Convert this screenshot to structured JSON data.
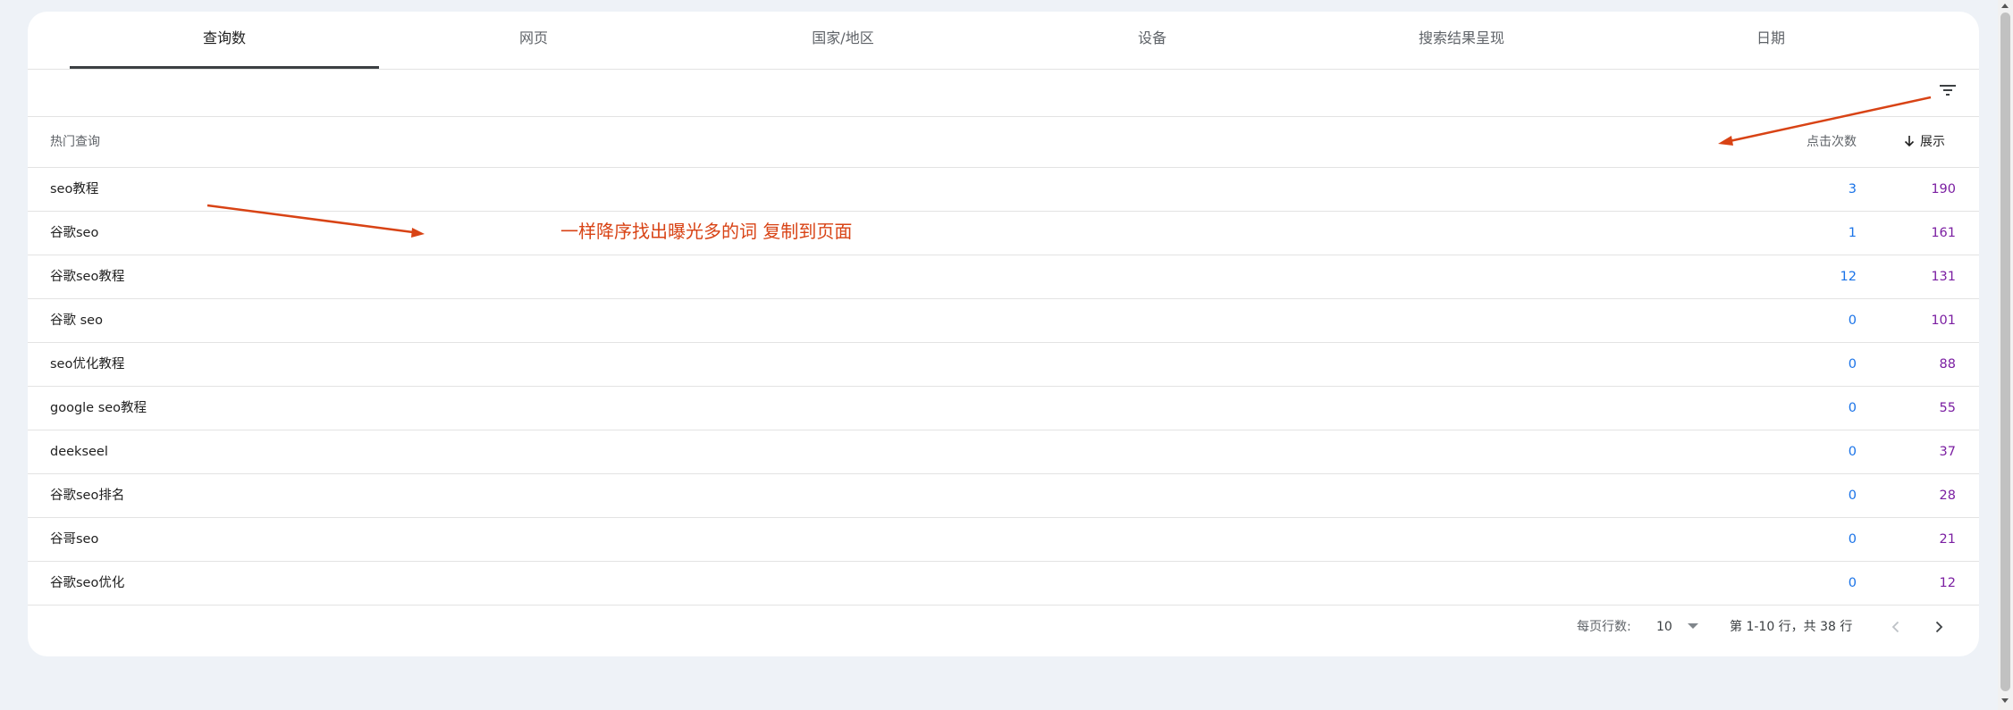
{
  "tabs": [
    {
      "label": "查询数",
      "active": true
    },
    {
      "label": "网页",
      "active": false
    },
    {
      "label": "国家/地区",
      "active": false
    },
    {
      "label": "设备",
      "active": false
    },
    {
      "label": "搜索结果呈现",
      "active": false
    },
    {
      "label": "日期",
      "active": false
    }
  ],
  "table": {
    "headers": {
      "query": "热门查询",
      "clicks": "点击次数",
      "impressions": "展示"
    },
    "sort": {
      "column": "impressions",
      "direction": "descending",
      "icon": "arrow-down-icon"
    },
    "rows": [
      {
        "query": "seo教程",
        "clicks": "3",
        "impressions": "190"
      },
      {
        "query": "谷歌seo",
        "clicks": "1",
        "impressions": "161"
      },
      {
        "query": "谷歌seo教程",
        "clicks": "12",
        "impressions": "131"
      },
      {
        "query": "谷歌 seo",
        "clicks": "0",
        "impressions": "101"
      },
      {
        "query": "seo优化教程",
        "clicks": "0",
        "impressions": "88"
      },
      {
        "query": "google seo教程",
        "clicks": "0",
        "impressions": "55"
      },
      {
        "query": "deekseel",
        "clicks": "0",
        "impressions": "37"
      },
      {
        "query": "谷歌seo排名",
        "clicks": "0",
        "impressions": "28"
      },
      {
        "query": "谷哥seo",
        "clicks": "0",
        "impressions": "21"
      },
      {
        "query": "谷歌seo优化",
        "clicks": "0",
        "impressions": "12"
      }
    ]
  },
  "footer": {
    "rows_per_page_label": "每页行数:",
    "rows_per_page_value": "10",
    "range_text": "第 1-10 行，共 38 行"
  },
  "annotation": {
    "note": "一样降序找出曝光多的词 复制到页面",
    "color": "#d84315"
  },
  "colors": {
    "clicks": "#1a73e8",
    "impressions": "#7b1fa2",
    "background": "#eef2f7"
  },
  "icons": [
    "filter-icon",
    "arrow-down-icon",
    "chevron-left-icon",
    "chevron-right-icon",
    "dropdown-caret-icon"
  ]
}
